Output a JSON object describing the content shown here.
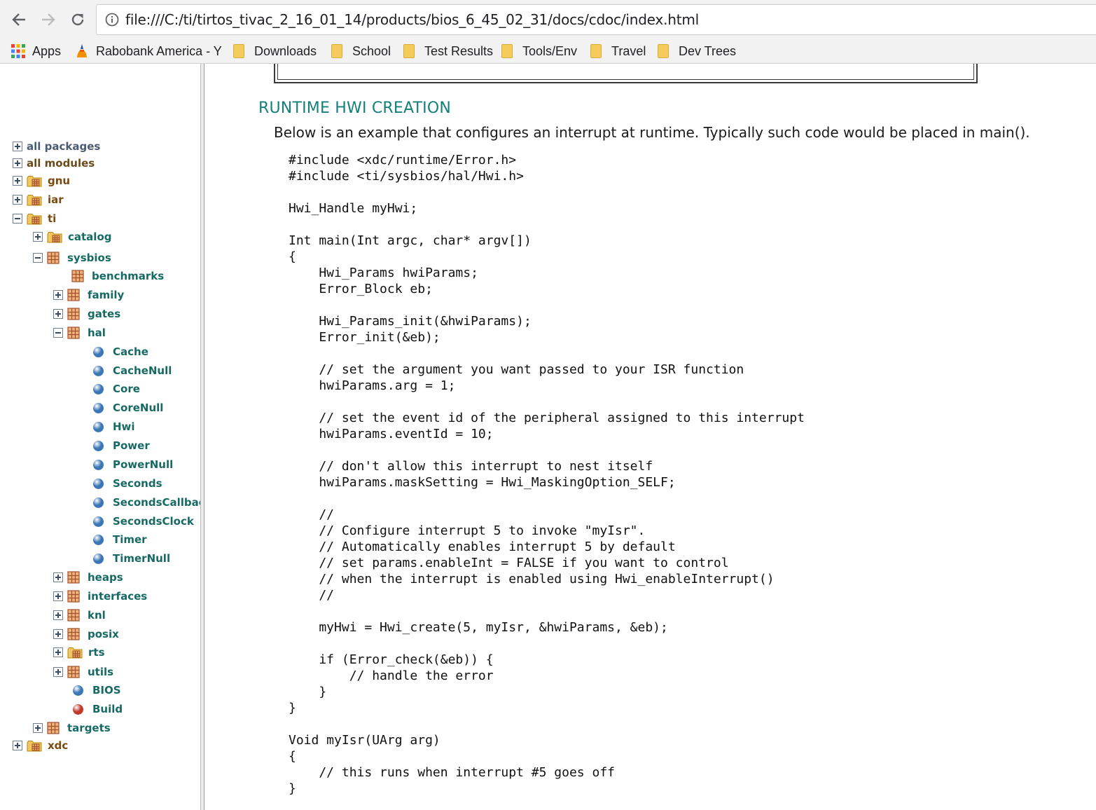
{
  "browser": {
    "url": "file:///C:/ti/tirtos_tivac_2_16_01_14/products/bios_6_45_02_31/docs/cdoc/index.html",
    "bookmarks": [
      "Apps",
      "Rabobank America - Y",
      "Downloads",
      "School",
      "Test Results",
      "Tools/Env",
      "Travel",
      "Dev Trees"
    ]
  },
  "colors": {
    "tree_label": "#176a64",
    "tree_label_dark": "#7a4a10",
    "module_ball": "#3b76b6",
    "build_ball": "#c0392b",
    "heading": "#14807a"
  },
  "tree": {
    "nodes": [
      {
        "label": "all packages",
        "expander": "plus",
        "icon": "none"
      },
      {
        "label": "all modules",
        "expander": "plus",
        "icon": "none"
      },
      {
        "label": "gnu",
        "expander": "plus",
        "icon": "package-folder-icon"
      },
      {
        "label": "iar",
        "expander": "plus",
        "icon": "package-folder-icon"
      },
      {
        "label": "ti",
        "expander": "minus",
        "icon": "package-folder-icon"
      },
      {
        "label": "catalog",
        "expander": "plus",
        "icon": "package-folder-icon"
      },
      {
        "label": "sysbios",
        "expander": "minus",
        "icon": "package-icon"
      },
      {
        "label": "benchmarks",
        "expander": "none",
        "icon": "package-icon"
      },
      {
        "label": "family",
        "expander": "plus",
        "icon": "package-icon"
      },
      {
        "label": "gates",
        "expander": "plus",
        "icon": "package-icon"
      },
      {
        "label": "hal",
        "expander": "minus",
        "icon": "package-icon"
      },
      {
        "label": "Cache",
        "expander": "none",
        "icon": "module-icon"
      },
      {
        "label": "CacheNull",
        "expander": "none",
        "icon": "module-icon"
      },
      {
        "label": "Core",
        "expander": "none",
        "icon": "module-icon"
      },
      {
        "label": "CoreNull",
        "expander": "none",
        "icon": "module-icon"
      },
      {
        "label": "Hwi",
        "expander": "none",
        "icon": "module-icon"
      },
      {
        "label": "Power",
        "expander": "none",
        "icon": "module-icon"
      },
      {
        "label": "PowerNull",
        "expander": "none",
        "icon": "module-icon"
      },
      {
        "label": "Seconds",
        "expander": "none",
        "icon": "module-icon"
      },
      {
        "label": "SecondsCallbac",
        "expander": "none",
        "icon": "module-icon"
      },
      {
        "label": "SecondsClock",
        "expander": "none",
        "icon": "module-icon"
      },
      {
        "label": "Timer",
        "expander": "none",
        "icon": "module-icon"
      },
      {
        "label": "TimerNull",
        "expander": "none",
        "icon": "module-icon"
      },
      {
        "label": "heaps",
        "expander": "plus",
        "icon": "package-icon"
      },
      {
        "label": "interfaces",
        "expander": "plus",
        "icon": "package-icon"
      },
      {
        "label": "knl",
        "expander": "plus",
        "icon": "package-icon"
      },
      {
        "label": "posix",
        "expander": "plus",
        "icon": "package-icon"
      },
      {
        "label": "rts",
        "expander": "plus",
        "icon": "package-folder-icon"
      },
      {
        "label": "utils",
        "expander": "plus",
        "icon": "package-icon"
      },
      {
        "label": "BIOS",
        "expander": "none",
        "icon": "module-icon"
      },
      {
        "label": "Build",
        "expander": "none",
        "icon": "module-icon-red"
      },
      {
        "label": "targets",
        "expander": "plus",
        "icon": "package-icon"
      },
      {
        "label": "xdc",
        "expander": "plus",
        "icon": "package-folder-icon"
      }
    ]
  },
  "content": {
    "heading": "RUNTIME HWI CREATION",
    "intro": "Below is an example that configures an interrupt at runtime. Typically such code would be placed in main().",
    "code_lines": [
      "#include <xdc/runtime/Error.h>",
      "#include <ti/sysbios/hal/Hwi.h>",
      "",
      "Hwi_Handle myHwi;",
      "",
      "Int main(Int argc, char* argv[])",
      "{",
      "    Hwi_Params hwiParams;",
      "    Error_Block eb;",
      "",
      "    Hwi_Params_init(&hwiParams);",
      "    Error_init(&eb);",
      "",
      "    // set the argument you want passed to your ISR function",
      "    hwiParams.arg = 1;",
      "",
      "    // set the event id of the peripheral assigned to this interrupt",
      "    hwiParams.eventId = 10;",
      "",
      "    // don't allow this interrupt to nest itself",
      "    hwiParams.maskSetting = Hwi_MaskingOption_SELF;",
      "",
      "    //",
      "    // Configure interrupt 5 to invoke \"myIsr\".",
      "    // Automatically enables interrupt 5 by default",
      "    // set params.enableInt = FALSE if you want to control",
      "    // when the interrupt is enabled using Hwi_enableInterrupt()",
      "    //",
      "",
      "    myHwi = Hwi_create(5, myIsr, &hwiParams, &eb);",
      "",
      "    if (Error_check(&eb)) {",
      "        // handle the error",
      "    }",
      "}",
      "",
      "Void myIsr(UArg arg)",
      "{",
      "    // this runs when interrupt #5 goes off",
      "}"
    ]
  }
}
